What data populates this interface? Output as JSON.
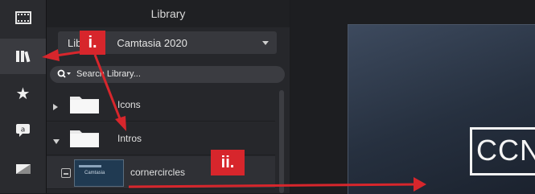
{
  "toolbar": {
    "items": [
      {
        "name": "media-icon"
      },
      {
        "name": "library-icon"
      },
      {
        "name": "favorites-star-icon"
      },
      {
        "name": "annotations-icon"
      },
      {
        "name": "transitions-icon"
      }
    ]
  },
  "library": {
    "title": "Library",
    "dropdown_value": "Library: Camtasia 2020",
    "dropdown_visible_prefix": "Lib",
    "dropdown_visible_suffix": "Camtasia 2020",
    "search_placeholder": "Search Library...",
    "items": [
      {
        "label": "Icons",
        "expanded": false,
        "type": "folder"
      },
      {
        "label": "Intros",
        "expanded": true,
        "type": "folder"
      },
      {
        "label": "cornercircles",
        "type": "clip",
        "thumb_text": "Camtasia"
      }
    ]
  },
  "preview": {
    "logo_text": "CCN"
  },
  "annotations": {
    "badge_i": "i.",
    "badge_ii": "ii."
  },
  "colors": {
    "badge_red": "#d7262c",
    "panel_bg": "#26272b",
    "toolbar_bg": "#2a2b2f"
  }
}
